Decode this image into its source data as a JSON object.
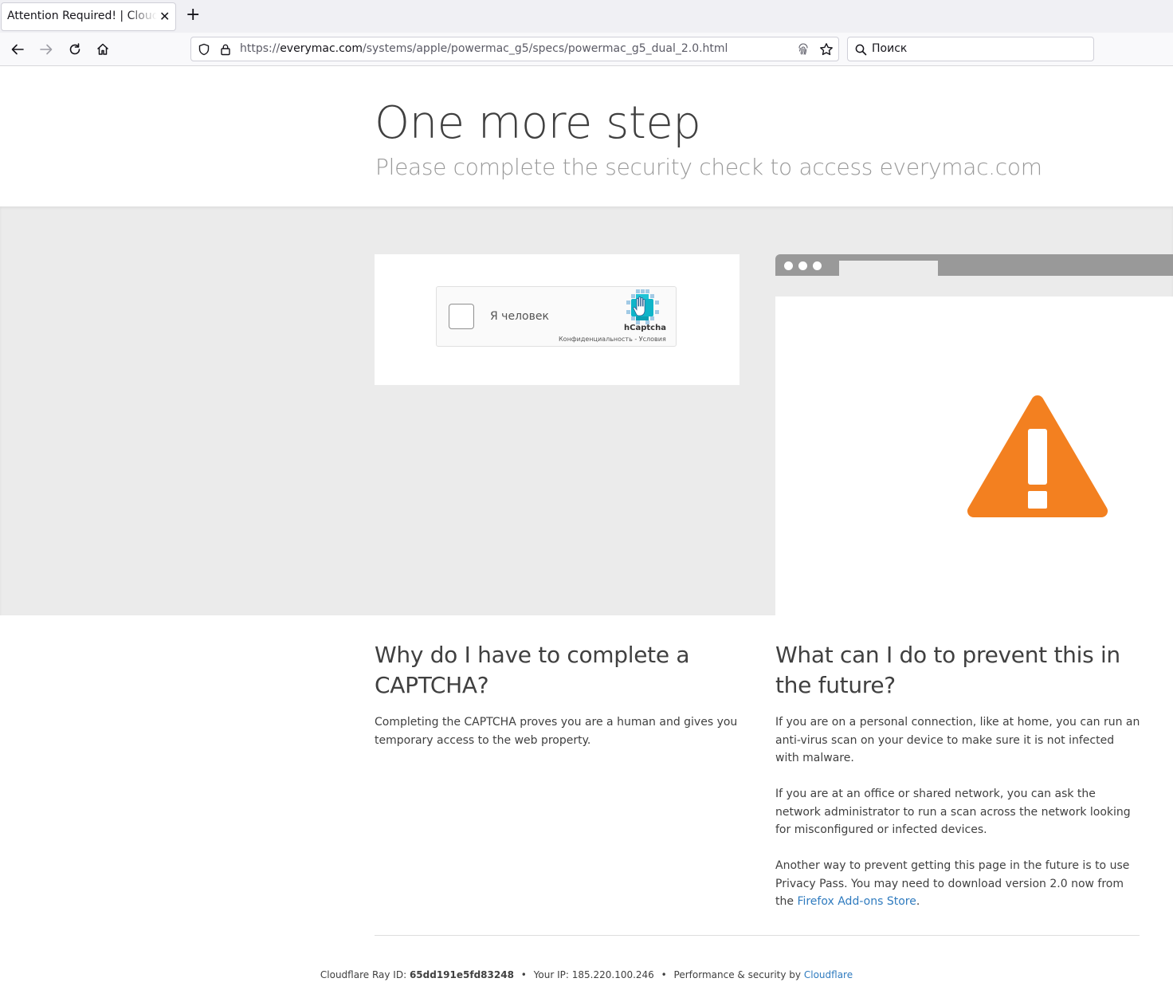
{
  "browser": {
    "tab_title": "Attention Required! | Cloudflare",
    "url_prefix": "https://",
    "url_host": "everymac.com",
    "url_path": "/systems/apple/powermac_g5/specs/powermac_g5_dual_2.0.html",
    "search_placeholder": "Поиск"
  },
  "page": {
    "title": "One more step",
    "subtitle": "Please complete the security check to access everymac.com"
  },
  "captcha": {
    "label": "Я человек",
    "brand": "hCaptcha",
    "links": "Конфиденциальность - Условия"
  },
  "why": {
    "title": "Why do I have to complete a CAPTCHA?",
    "text": "Completing the CAPTCHA proves you are a human and gives you temporary access to the web property."
  },
  "prevent": {
    "title": "What can I do to prevent this in the future?",
    "p1": "If you are on a personal connection, like at home, you can run an anti-virus scan on your device to make sure it is not infected with malware.",
    "p2": "If you are at an office or shared network, you can ask the network administrator to run a scan across the network looking for misconfigured or infected devices.",
    "p3_before": "Another way to prevent getting this page in the future is to use Privacy Pass. You may need to download version 2.0 now from the ",
    "p3_link": "Firefox Add-ons Store",
    "p3_after": "."
  },
  "footer": {
    "ray_label": "Cloudflare Ray ID:",
    "ray_id": "65dd191e5fd83248",
    "ip_label": "Your IP:",
    "ip": "185.220.100.246",
    "perf_label": "Performance & security by",
    "perf_link": "Cloudflare"
  },
  "colors": {
    "warning_orange": "#f38020",
    "link_blue": "#2f7bbf",
    "band_gray": "#ebebeb"
  }
}
